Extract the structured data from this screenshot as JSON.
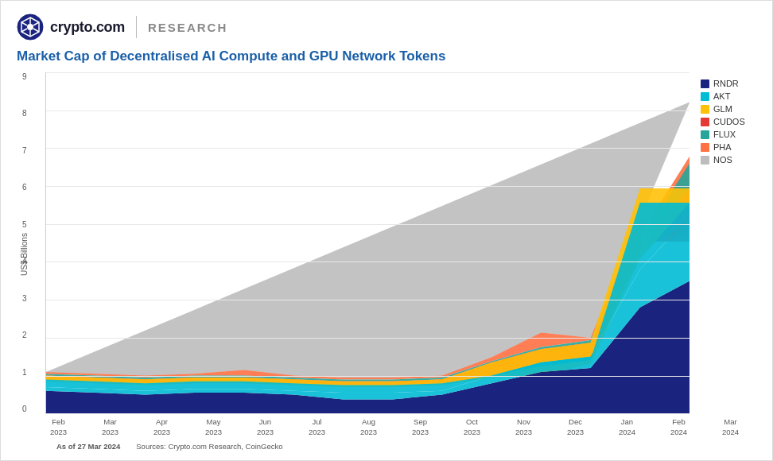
{
  "header": {
    "logo_text": "crypto.com",
    "research_label": "RESEARCH"
  },
  "chart": {
    "title": "Market Cap of Decentralised AI Compute and GPU Network Tokens",
    "y_axis_label": "US$ Billions",
    "y_ticks": [
      "9",
      "8",
      "7",
      "6",
      "5",
      "4",
      "3",
      "2",
      "1",
      "0"
    ],
    "x_labels": [
      {
        "line1": "Feb",
        "line2": "2023"
      },
      {
        "line1": "Mar",
        "line2": "2023"
      },
      {
        "line1": "Apr",
        "line2": "2023"
      },
      {
        "line1": "May",
        "line2": "2023"
      },
      {
        "line1": "Jun",
        "line2": "2023"
      },
      {
        "line1": "Jul",
        "line2": "2023"
      },
      {
        "line1": "Aug",
        "line2": "2023"
      },
      {
        "line1": "Sep",
        "line2": "2023"
      },
      {
        "line1": "Oct",
        "line2": "2023"
      },
      {
        "line1": "Nov",
        "line2": "2023"
      },
      {
        "line1": "Dec",
        "line2": "2023"
      },
      {
        "line1": "Jan",
        "line2": "2024"
      },
      {
        "line1": "Feb",
        "line2": "2024"
      },
      {
        "line1": "Mar",
        "line2": "2024"
      }
    ],
    "legend": [
      {
        "label": "RNDR",
        "color": "#1a237e"
      },
      {
        "label": "AKT",
        "color": "#00bcd4"
      },
      {
        "label": "GLM",
        "color": "#ffc107"
      },
      {
        "label": "CUDOS",
        "color": "#e53935"
      },
      {
        "label": "FLUX",
        "color": "#26a69a"
      },
      {
        "label": "PHA",
        "color": "#ff7043"
      },
      {
        "label": "NOS",
        "color": "#bdbdbd"
      }
    ]
  },
  "footer": {
    "date_text": "As of 27 Mar 2024",
    "sources_text": "Sources: Crypto.com Research, CoinGecko"
  }
}
